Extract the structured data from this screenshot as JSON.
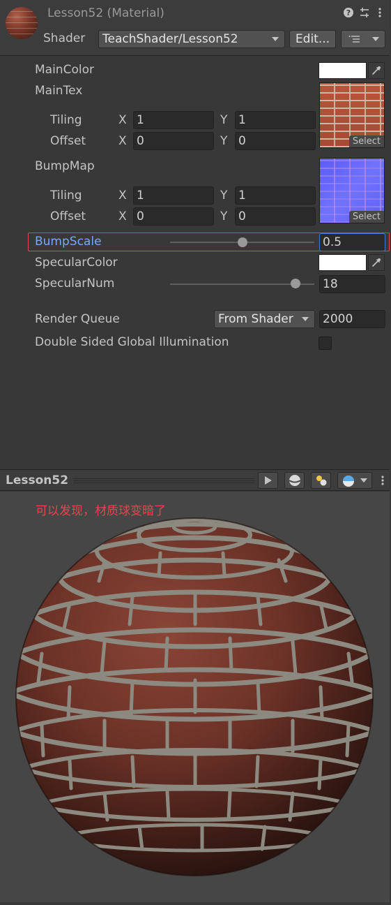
{
  "header": {
    "title": "Lesson52 (Material)",
    "shader_label": "Shader",
    "shader_value": "TeachShader/Lesson52",
    "edit_label": "Edit...",
    "icons": [
      "help-icon",
      "preset-icon",
      "menu-icon",
      "list-icon"
    ]
  },
  "properties": {
    "main_color": {
      "label": "MainColor",
      "value": "#ffffff"
    },
    "main_tex": {
      "label": "MainTex",
      "tiling_label": "Tiling",
      "offset_label": "Offset",
      "tiling_x": "1",
      "tiling_y": "1",
      "offset_x": "0",
      "offset_y": "0",
      "select_label": "Select",
      "preview": "brick-texture"
    },
    "bump_map": {
      "label": "BumpMap",
      "tiling_label": "Tiling",
      "offset_label": "Offset",
      "tiling_x": "1",
      "tiling_y": "1",
      "offset_x": "0",
      "offset_y": "0",
      "select_label": "Select",
      "preview": "normal-map-texture"
    },
    "bump_scale": {
      "label": "BumpScale",
      "value": "0.5",
      "slider_fraction": 0.5
    },
    "specular_color": {
      "label": "SpecularColor",
      "value": "#ffffff"
    },
    "specular_num": {
      "label": "SpecularNum",
      "value": "18",
      "slider_fraction": 0.87
    },
    "axis_x": "X",
    "axis_y": "Y"
  },
  "render_queue": {
    "label": "Render Queue",
    "mode": "From Shader",
    "value": "2000"
  },
  "double_sided_gi": {
    "label": "Double Sided Global Illumination",
    "checked": false
  },
  "preview": {
    "title": "Lesson52",
    "annotation": "可以发现，材质球变暗了",
    "annotation_color": "#e8434e",
    "highlight_color": "#e8434e",
    "accent_color": "#7aa7ff"
  }
}
